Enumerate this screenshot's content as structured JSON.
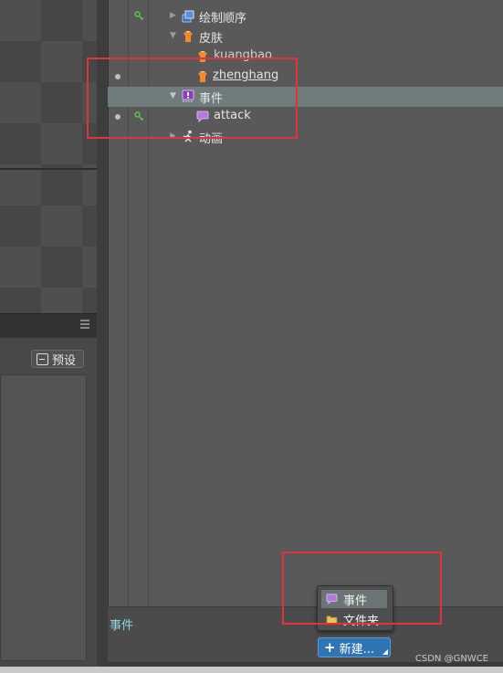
{
  "tree": {
    "items": [
      {
        "label": "绘制顺序",
        "icon": "draw-order-icon"
      },
      {
        "label": "皮肤",
        "icon": "skins-folder-icon"
      },
      {
        "label": "kuangbao",
        "icon": "skin-icon"
      },
      {
        "label": "zhenghang",
        "icon": "skin-icon"
      },
      {
        "label": "事件",
        "icon": "events-folder-icon"
      },
      {
        "label": "attack",
        "icon": "event-icon"
      },
      {
        "label": "动画",
        "icon": "animation-icon"
      }
    ]
  },
  "left_panel": {
    "preset_label": "预设"
  },
  "bottom": {
    "selected_label": "事件"
  },
  "popup": {
    "items": [
      {
        "label": "事件",
        "icon": "event-icon"
      },
      {
        "label": "文件夹",
        "icon": "folder-icon"
      }
    ]
  },
  "new_button": {
    "label": "新建..."
  },
  "watermark": "CSDN @GNWCE",
  "colors": {
    "selection": "#707c7c",
    "accent_blue": "#2f74b3",
    "key_green": "#5fc24f",
    "skin_orange": "#f08a2b",
    "event_purple": "#b679d8",
    "annotation_red": "#e0333b",
    "label_cyan": "#8fd7e8"
  }
}
